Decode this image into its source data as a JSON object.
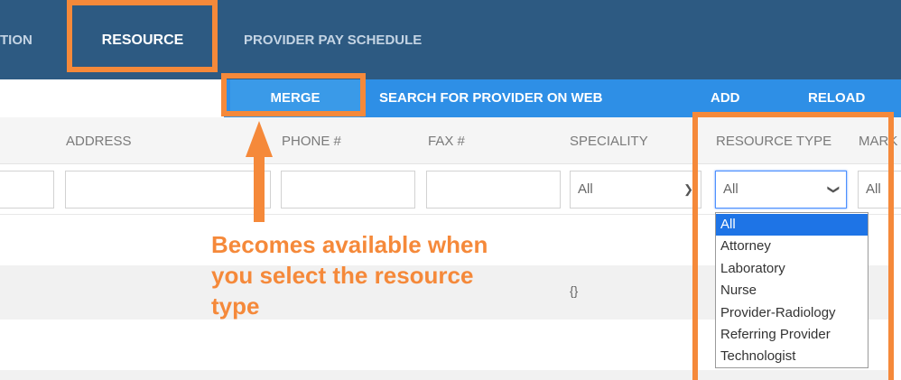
{
  "nav": {
    "tabs": [
      {
        "label": "TION"
      },
      {
        "label": "RESOURCE"
      },
      {
        "label": "PROVIDER PAY SCHEDULE"
      }
    ]
  },
  "actions": {
    "merge": "MERGE",
    "search_web": "SEARCH FOR PROVIDER ON WEB",
    "add": "ADD",
    "reload": "RELOAD"
  },
  "columns": {
    "address": "ADDRESS",
    "phone": "PHONE #",
    "fax": "FAX #",
    "speciality": "SPECIALITY",
    "resource_type": "RESOURCE TYPE",
    "mark": "MARK"
  },
  "filters": {
    "speciality_value": "All",
    "resource_type_value": "All",
    "mark_value": "All"
  },
  "rows": [
    {
      "speciality": ""
    },
    {
      "speciality": "{}"
    },
    {
      "speciality": ""
    }
  ],
  "resource_type_options": [
    "All",
    "Attorney",
    "Laboratory",
    "Nurse",
    "Provider-Radiology",
    "Referring Provider",
    "Technologist"
  ],
  "annotation": {
    "note": "Becomes available when you select the resource type",
    "color": "#f5893a"
  },
  "colors": {
    "nav_bg": "#2d5a82",
    "action_bg": "#2e8fe6",
    "selected_option": "#1e74e6"
  }
}
